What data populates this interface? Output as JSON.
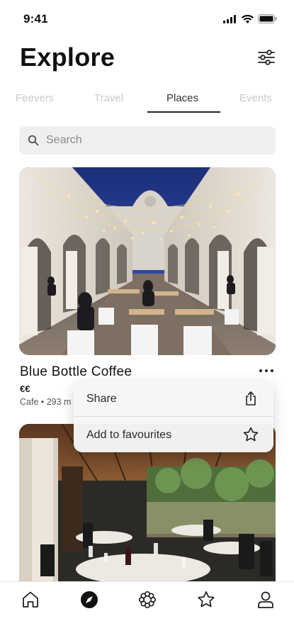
{
  "status": {
    "time": "9:41"
  },
  "header": {
    "title": "Explore"
  },
  "tabs": [
    {
      "label": "Feevers",
      "active": false
    },
    {
      "label": "Travel",
      "active": false
    },
    {
      "label": "Places",
      "active": true
    },
    {
      "label": "Events",
      "active": false
    }
  ],
  "search": {
    "placeholder": "Search"
  },
  "venue": {
    "name": "Blue Bottle Coffee",
    "price": "€€",
    "meta": "Cafe • 293 m"
  },
  "popup": {
    "share_label": "Share",
    "favourite_label": "Add to favourites"
  },
  "bottom_nav": [
    "home-icon",
    "compass-icon",
    "grid-icon",
    "star-icon",
    "profile-icon"
  ]
}
